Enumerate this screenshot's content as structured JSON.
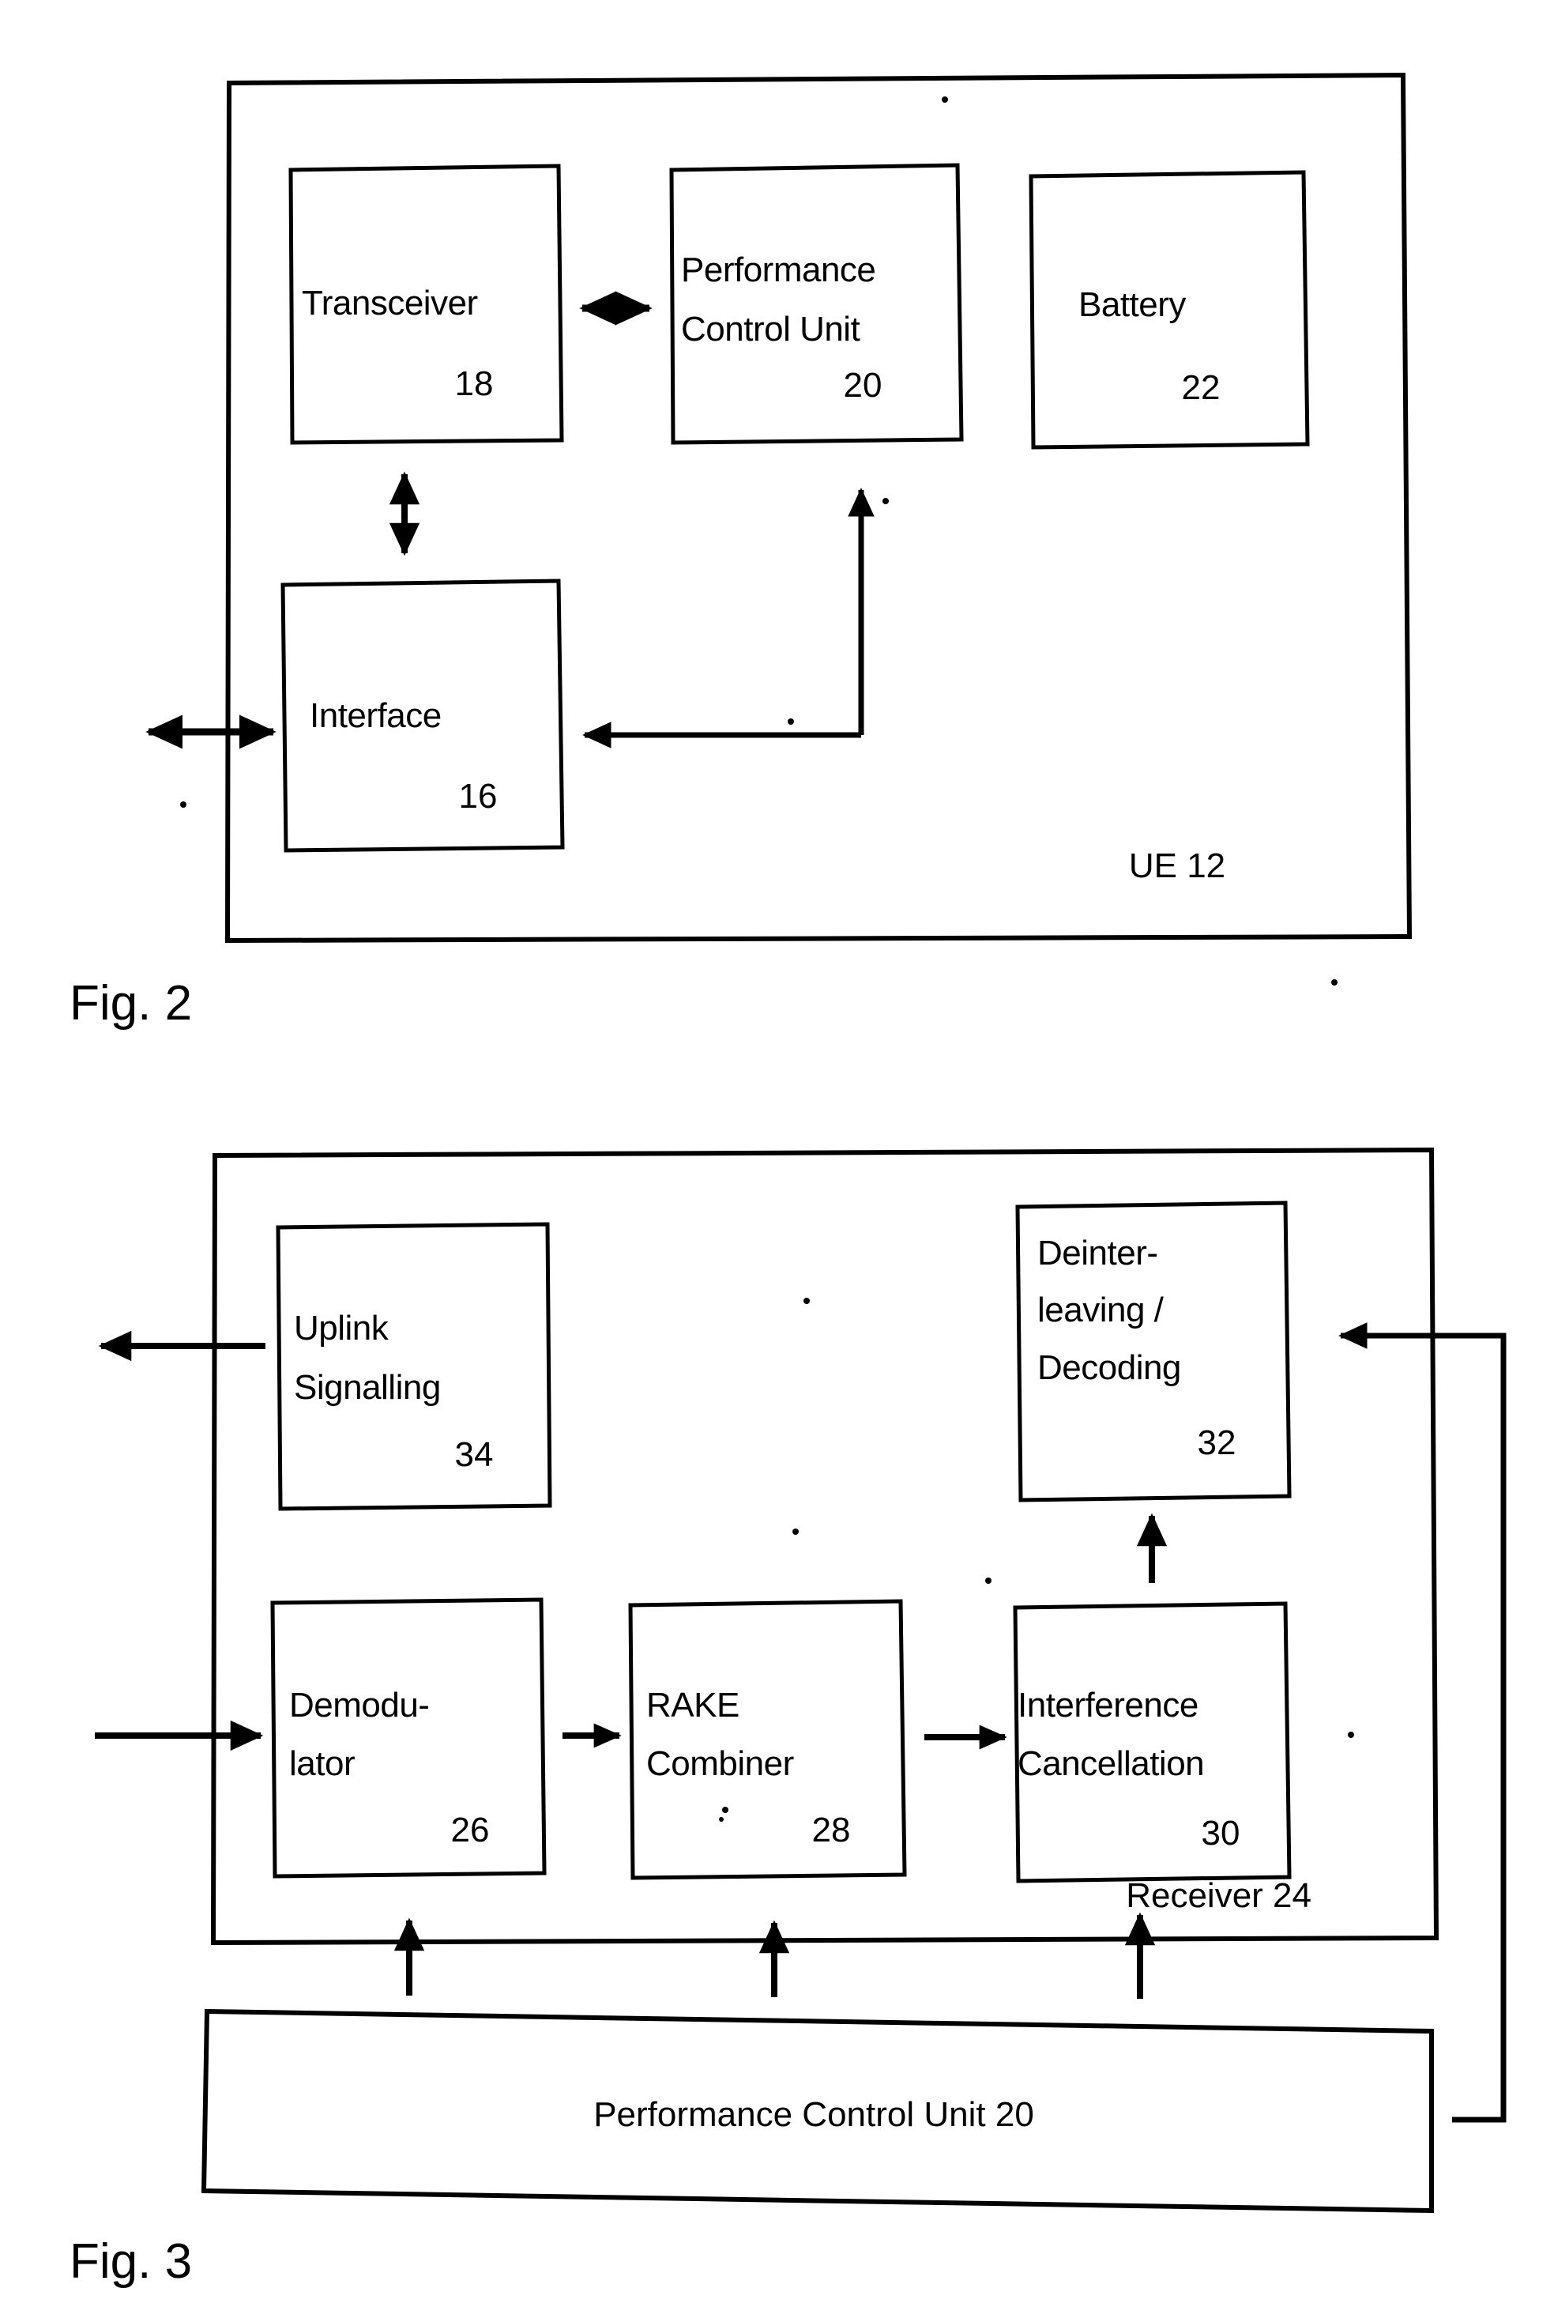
{
  "document": {
    "type": "patent-drawing-sheet",
    "figures": [
      {
        "caption": "Fig. 2",
        "container_label": "UE 12",
        "blocks": [
          {
            "name": "transceiver",
            "label_lines": [
              "Transceiver"
            ],
            "number": "18"
          },
          {
            "name": "performance-control",
            "label_lines": [
              "Performance",
              "Control Unit"
            ],
            "number": "20"
          },
          {
            "name": "battery",
            "label_lines": [
              "Battery"
            ],
            "number": "22"
          },
          {
            "name": "interface",
            "label_lines": [
              "Interface"
            ],
            "number": "16"
          }
        ],
        "connections": [
          {
            "from": "transceiver",
            "to": "performance-control",
            "style": "double-arrow",
            "orientation": "horizontal"
          },
          {
            "from": "transceiver",
            "to": "interface",
            "style": "double-arrow",
            "orientation": "vertical"
          },
          {
            "from": "interface",
            "to": "external",
            "style": "double-arrow",
            "orientation": "horizontal"
          },
          {
            "from": "performance-control",
            "to": "interface",
            "style": "single-arrow",
            "orientation": "elbow"
          }
        ]
      },
      {
        "caption": "Fig. 3",
        "container_label": "Receiver 24",
        "blocks": [
          {
            "name": "uplink-signalling",
            "label_lines": [
              "Uplink",
              "Signalling"
            ],
            "number": "34"
          },
          {
            "name": "deinterleaving-decoding",
            "label_lines": [
              "Deinter-",
              "leaving /",
              "Decoding"
            ],
            "number": "32"
          },
          {
            "name": "demodulator",
            "label_lines": [
              "Demodu-",
              "lator"
            ],
            "number": "26"
          },
          {
            "name": "rake-combiner",
            "label_lines": [
              "RAKE",
              "Combiner"
            ],
            "number": "28"
          },
          {
            "name": "interference-cancellation",
            "label_lines": [
              "Interference",
              "Cancellation"
            ],
            "number": "30"
          }
        ],
        "control_bar": {
          "label": "Performance Control Unit 20"
        },
        "connections": [
          {
            "from": "external",
            "to": "demodulator",
            "style": "single-arrow",
            "orientation": "horizontal"
          },
          {
            "from": "demodulator",
            "to": "rake-combiner",
            "style": "single-arrow",
            "orientation": "horizontal"
          },
          {
            "from": "rake-combiner",
            "to": "interference-cancellation",
            "style": "single-arrow",
            "orientation": "horizontal"
          },
          {
            "from": "interference-cancellation",
            "to": "deinterleaving-decoding",
            "style": "single-arrow",
            "orientation": "vertical"
          },
          {
            "from": "uplink-signalling",
            "to": "external",
            "style": "single-arrow",
            "orientation": "horizontal"
          },
          {
            "from": "control-bar",
            "to": "demodulator",
            "style": "single-arrow",
            "orientation": "vertical"
          },
          {
            "from": "control-bar",
            "to": "rake-combiner",
            "style": "single-arrow",
            "orientation": "vertical"
          },
          {
            "from": "control-bar",
            "to": "interference-cancellation",
            "style": "single-arrow",
            "orientation": "vertical"
          },
          {
            "from": "control-bar",
            "to": "deinterleaving-decoding",
            "style": "single-arrow",
            "orientation": "elbow-right"
          }
        ]
      }
    ]
  },
  "fig2": {
    "caption": "Fig. 2",
    "container_label": "UE 12",
    "transceiver": {
      "line1": "Transceiver",
      "number": "18"
    },
    "perf_control": {
      "line1": "Performance",
      "line2": "Control Unit",
      "number": "20"
    },
    "battery": {
      "line1": "Battery",
      "number": "22"
    },
    "interface": {
      "line1": "Interface",
      "number": "16"
    }
  },
  "fig3": {
    "caption": "Fig. 3",
    "container_label": "Receiver 24",
    "uplink": {
      "line1": "Uplink",
      "line2": "Signalling",
      "number": "34"
    },
    "deinterleave": {
      "line1": "Deinter-",
      "line2": "leaving /",
      "line3": "Decoding",
      "number": "32"
    },
    "demodulator": {
      "line1": "Demodu-",
      "line2": "lator",
      "number": "26"
    },
    "rake": {
      "line1": "RAKE",
      "line2": "Combiner",
      "number": "28"
    },
    "interference": {
      "line1": "Interference",
      "line2": "Cancellation",
      "number": "30"
    },
    "control_bar": {
      "label": "Performance Control Unit 20"
    }
  },
  "colors": {
    "ink": "#000000",
    "paper": "#ffffff"
  }
}
